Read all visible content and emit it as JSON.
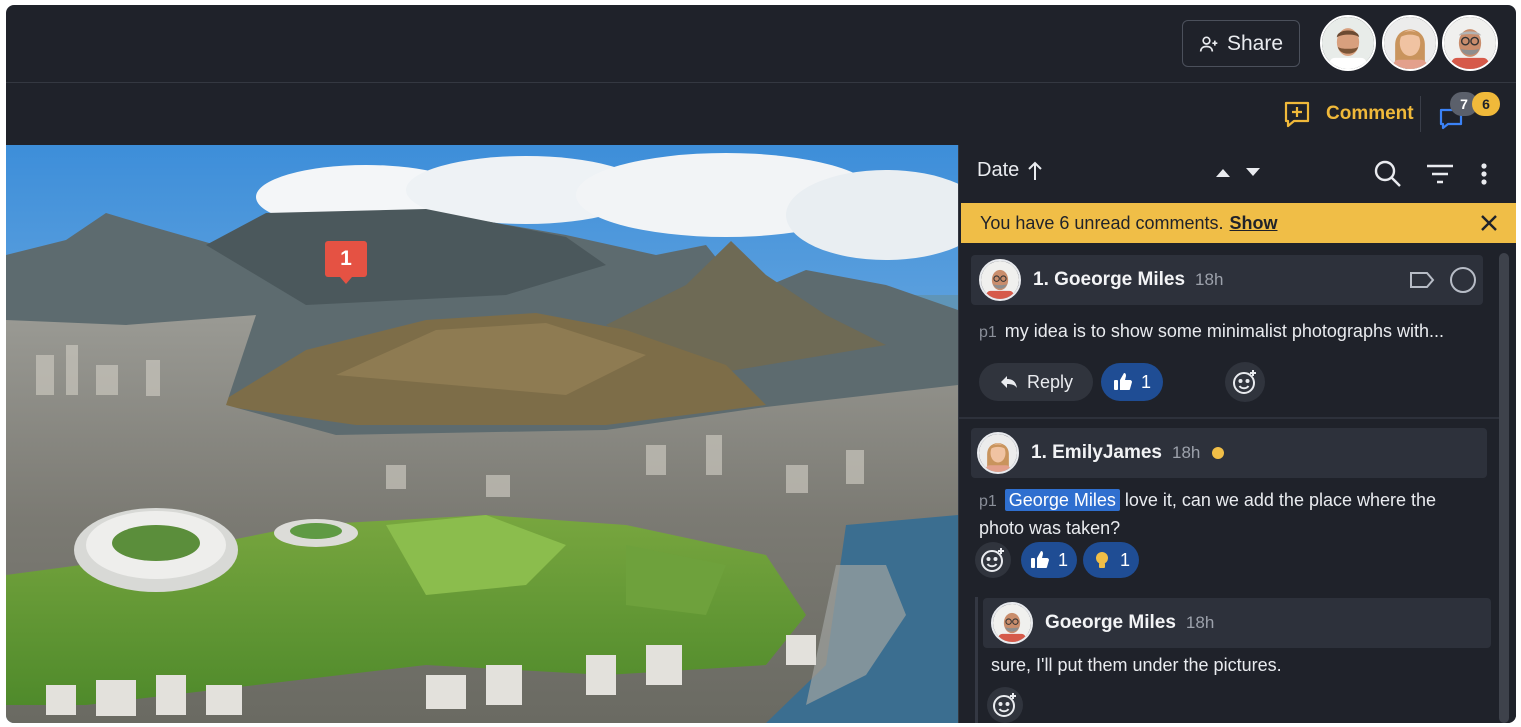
{
  "header": {
    "share_label": "Share",
    "share_icon": "add-person-icon",
    "collaborators": [
      "avatar-man-beard",
      "avatar-woman",
      "avatar-man-glasses"
    ]
  },
  "subbar": {
    "comment_label": "Comment",
    "total_count": "7",
    "unread_count": "6"
  },
  "canvas": {
    "pin_number": "1"
  },
  "panel": {
    "sort_label": "Date",
    "banner": {
      "text": "You have 6 unread comments.",
      "show_label": "Show"
    },
    "comments": [
      {
        "author": "1. Goeorge Miles",
        "time": "18h",
        "page": "p1",
        "body": "my idea is to show some minimalist photographs with...",
        "reply_label": "Reply",
        "likes": "1"
      },
      {
        "author": "1. EmilyJames",
        "time": "18h",
        "page": "p1",
        "mention": "George Miles",
        "body": " love it, can we add the place where the photo was taken?",
        "likes": "1",
        "ideas": "1",
        "replies": [
          {
            "author": "Goeorge Miles",
            "time": "18h",
            "body": "sure, I'll put them under the pictures."
          }
        ]
      }
    ]
  },
  "colors": {
    "accent_yellow": "#f0be47",
    "pin_red": "#e55243",
    "like_blue": "#1f4d94",
    "mention_blue": "#2f6fcf",
    "background": "#1f222a"
  }
}
